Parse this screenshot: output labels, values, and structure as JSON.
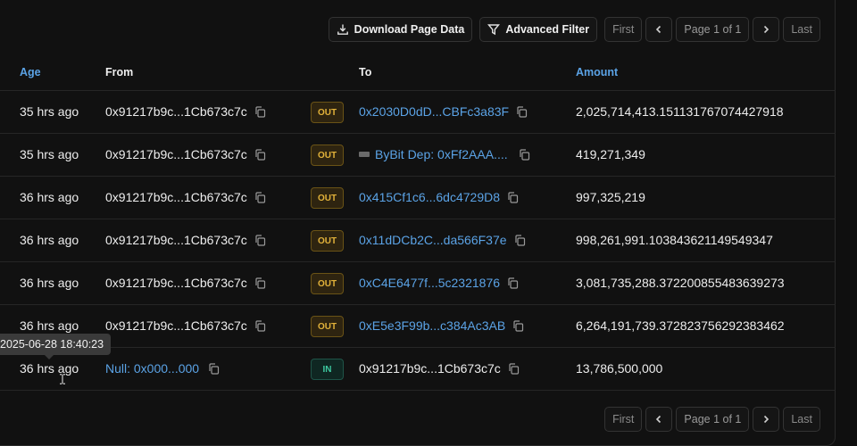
{
  "toolbar": {
    "download_label": "Download Page Data",
    "filter_label": "Advanced Filter",
    "first": "First",
    "page": "Page 1 of 1",
    "last": "Last"
  },
  "columns": {
    "age": "Age",
    "from": "From",
    "to": "To",
    "amount": "Amount"
  },
  "rows": [
    {
      "age": "35 hrs ago",
      "from": "0x91217b9c...1Cb673c7c",
      "dir": "OUT",
      "to": "0x2030D0dD...CBFc3a83F",
      "amount": "2,025,714,413.151131767074427918"
    },
    {
      "age": "35 hrs ago",
      "from": "0x91217b9c...1Cb673c7c",
      "dir": "OUT",
      "to": "ByBit Dep: 0xFf2AAA....",
      "amount": "419,271,349"
    },
    {
      "age": "36 hrs ago",
      "from": "0x91217b9c...1Cb673c7c",
      "dir": "OUT",
      "to": "0x415Cf1c6...6dc4729D8",
      "amount": "997,325,219"
    },
    {
      "age": "36 hrs ago",
      "from": "0x91217b9c...1Cb673c7c",
      "dir": "OUT",
      "to": "0x11dDCb2C...da566F37e",
      "amount": "998,261,991.103843621149549347"
    },
    {
      "age": "36 hrs ago",
      "from": "0x91217b9c...1Cb673c7c",
      "dir": "OUT",
      "to": "0xC4E6477f...5c2321876",
      "amount": "3,081,735,288.372200855483639273"
    },
    {
      "age": "36 hrs ago",
      "from": "0x91217b9c...1Cb673c7c",
      "dir": "OUT",
      "to": "0xE5e3F99b...c384Ac3AB",
      "amount": "6,264,191,739.372823756292383462"
    },
    {
      "age": "36 hrs ago",
      "from": "Null: 0x000...000",
      "dir": "IN",
      "to": "0x91217b9c...1Cb673c7c",
      "amount": "13,786,500,000"
    }
  ],
  "tooltip": "2025-06-28 18:40:23",
  "footer": {
    "first": "First",
    "page": "Page 1 of 1",
    "last": "Last"
  },
  "colors": {
    "link": "#5ba3e6",
    "out_badge": "#e2b23a",
    "in_badge": "#3ec9a0"
  }
}
